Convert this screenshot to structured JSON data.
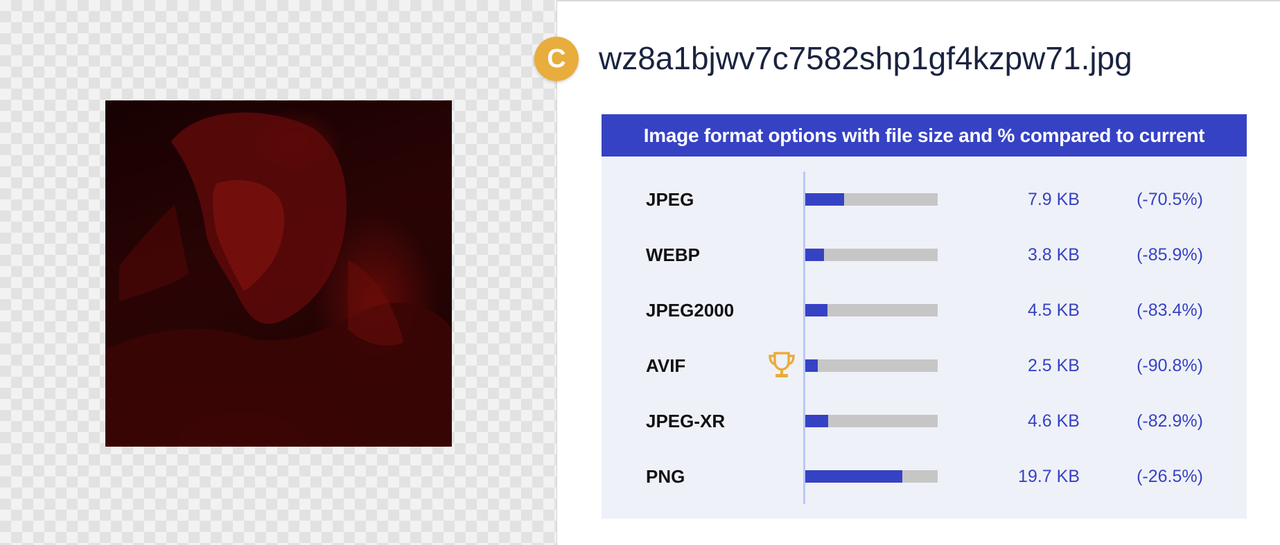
{
  "file": {
    "badge_letter": "C",
    "badge_color": "#e8ad3c",
    "name": "wz8a1bjwv7c7582shp1gf4kzpw71.jpg"
  },
  "card": {
    "title": "Image format options with file size and % compared to current",
    "accent_color": "#3642c4",
    "best_icon": "trophy-icon",
    "formats": [
      {
        "name": "JPEG",
        "size": "7.9 KB",
        "change": "(-70.5%)",
        "bar_fraction": 0.295,
        "best": false
      },
      {
        "name": "WEBP",
        "size": "3.8 KB",
        "change": "(-85.9%)",
        "bar_fraction": 0.141,
        "best": false
      },
      {
        "name": "JPEG2000",
        "size": "4.5 KB",
        "change": "(-83.4%)",
        "bar_fraction": 0.166,
        "best": false
      },
      {
        "name": "AVIF",
        "size": "2.5 KB",
        "change": "(-90.8%)",
        "bar_fraction": 0.092,
        "best": true
      },
      {
        "name": "JPEG-XR",
        "size": "4.6 KB",
        "change": "(-82.9%)",
        "bar_fraction": 0.171,
        "best": false
      },
      {
        "name": "PNG",
        "size": "19.7 KB",
        "change": "(-26.5%)",
        "bar_fraction": 0.735,
        "best": false
      }
    ]
  }
}
